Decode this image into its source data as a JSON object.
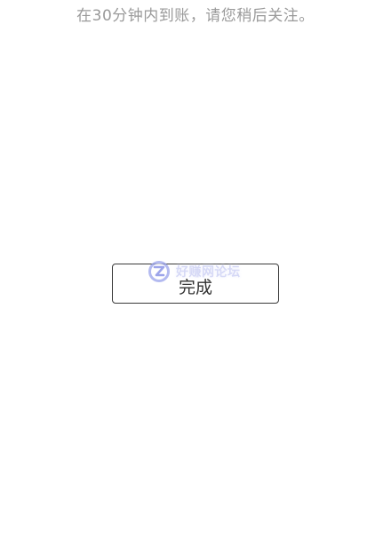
{
  "notice": {
    "text": "在30分钟内到账，请您稍后关注。"
  },
  "actions": {
    "done_label": "完成"
  },
  "watermark": {
    "text": "好赚网论坛",
    "logo_icon": "z-logo-icon",
    "color": "#c9cdf4"
  }
}
